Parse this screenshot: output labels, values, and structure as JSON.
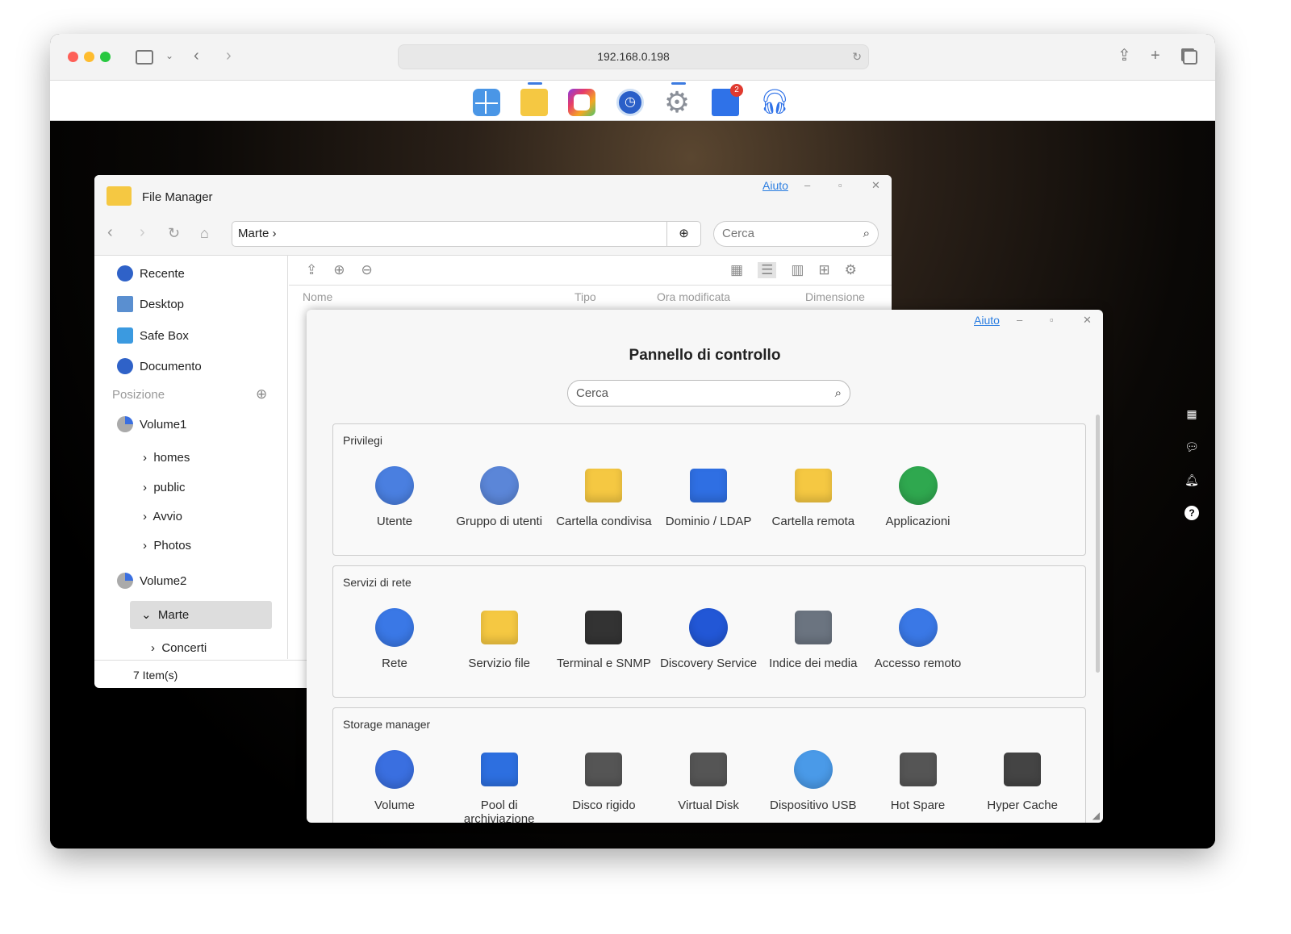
{
  "browser": {
    "url": "192.168.0.198"
  },
  "dock": {
    "badge": "2",
    "apps": [
      "layout-app",
      "file-station",
      "media-app",
      "backup-app",
      "control-panel",
      "app-center",
      "support-center"
    ]
  },
  "file_manager": {
    "title": "File Manager",
    "help": "Aiuto",
    "path": "Marte",
    "search_placeholder": "Cerca",
    "sidebar": {
      "quick": [
        "Recente",
        "Desktop",
        "Safe Box",
        "Documento"
      ],
      "section": "Posizione",
      "volume1": "Volume1",
      "volume1_folders": [
        "homes",
        "public",
        "Avvio",
        "Photos"
      ],
      "volume2": "Volume2",
      "selected": "Marte",
      "subfolder": "Concerti"
    },
    "columns": [
      "Nome",
      "Tipo",
      "Ora modificata",
      "Dimensione"
    ],
    "status": "7 Item(s)"
  },
  "control_panel": {
    "title": "Pannello di controllo",
    "help": "Aiuto",
    "search_placeholder": "Cerca",
    "sections": [
      {
        "title": "Privilegi",
        "items": [
          {
            "label": "Utente",
            "icon": "user-icon",
            "color": "#4a7fe0"
          },
          {
            "label": "Gruppo di utenti",
            "icon": "user-group-icon",
            "color": "#5b86d8"
          },
          {
            "label": "Cartella condivisa",
            "icon": "shared-folder-icon",
            "color": "#f5c842"
          },
          {
            "label": "Dominio / LDAP",
            "icon": "domain-icon",
            "color": "#2f6fe3"
          },
          {
            "label": "Cartella remota",
            "icon": "remote-folder-icon",
            "color": "#f5c842"
          },
          {
            "label": "Applicazioni",
            "icon": "applications-icon",
            "color": "#2fa84f"
          }
        ]
      },
      {
        "title": "Servizi di rete",
        "items": [
          {
            "label": "Rete",
            "icon": "globe-icon",
            "color": "#3a78e6"
          },
          {
            "label": "Servizio file",
            "icon": "file-service-icon",
            "color": "#f5c842"
          },
          {
            "label": "Terminal e SNMP",
            "icon": "terminal-icon",
            "color": "#333333"
          },
          {
            "label": "Discovery Service",
            "icon": "discovery-icon",
            "color": "#2257d6"
          },
          {
            "label": "Indice dei media",
            "icon": "media-index-icon",
            "color": "#6b7480"
          },
          {
            "label": "Accesso remoto",
            "icon": "remote-access-icon",
            "color": "#3a78e6"
          }
        ]
      },
      {
        "title": "Storage manager",
        "items": [
          {
            "label": "Volume",
            "icon": "volume-icon",
            "color": "#3a6fe0"
          },
          {
            "label": "Pool di archiviazione",
            "icon": "storage-pool-icon",
            "color": "#2d6fe0"
          },
          {
            "label": "Disco rigido",
            "icon": "hard-disk-icon",
            "color": "#555555"
          },
          {
            "label": "Virtual Disk",
            "icon": "virtual-disk-icon",
            "color": "#555555"
          },
          {
            "label": "Dispositivo USB",
            "icon": "usb-icon",
            "color": "#4a9ae8"
          },
          {
            "label": "Hot Spare",
            "icon": "hot-spare-icon",
            "color": "#555555"
          },
          {
            "label": "Hyper Cache",
            "icon": "hyper-cache-icon",
            "color": "#444444"
          }
        ]
      }
    ]
  }
}
